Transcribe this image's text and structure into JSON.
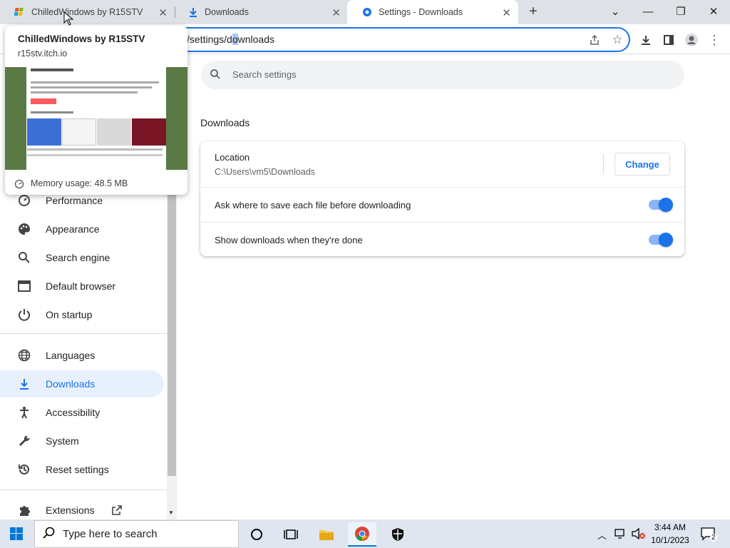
{
  "tabs": [
    {
      "title": "ChilledWindows by R15STV",
      "icon": "app-icon"
    },
    {
      "title": "Downloads",
      "icon": "download-icon"
    },
    {
      "title": "Settings - Downloads",
      "icon": "gear-icon"
    }
  ],
  "new_tab_label": "+",
  "window_controls": {
    "tab_search": "⌄",
    "minimize": "—",
    "restore": "❐",
    "close": "✕"
  },
  "address": {
    "prefix": "/settings/",
    "highlight": "o",
    "before_hl": "d",
    "after_hl": "wnloads"
  },
  "hovercard": {
    "title": "ChilledWindows by R15STV",
    "domain": "r15stv.itch.io",
    "memory": "Memory usage: 48.5 MB"
  },
  "sidebar": {
    "items": [
      {
        "label": "Performance",
        "icon": "speedometer-icon"
      },
      {
        "label": "Appearance",
        "icon": "palette-icon"
      },
      {
        "label": "Search engine",
        "icon": "search-icon"
      },
      {
        "label": "Default browser",
        "icon": "browser-icon"
      },
      {
        "label": "On startup",
        "icon": "power-icon"
      },
      {
        "label": "Languages",
        "icon": "globe-icon"
      },
      {
        "label": "Downloads",
        "icon": "download-icon"
      },
      {
        "label": "Accessibility",
        "icon": "accessibility-icon"
      },
      {
        "label": "System",
        "icon": "wrench-icon"
      },
      {
        "label": "Reset settings",
        "icon": "history-icon"
      },
      {
        "label": "Extensions",
        "icon": "puzzle-icon"
      }
    ]
  },
  "search": {
    "placeholder": "Search settings"
  },
  "section_title": "Downloads",
  "location": {
    "label": "Location",
    "path": "C:\\Users\\vm5\\Downloads",
    "change_label": "Change"
  },
  "settings": [
    {
      "label": "Ask where to save each file before downloading",
      "enabled": true
    },
    {
      "label": "Show downloads when they're done",
      "enabled": true
    }
  ],
  "taskbar": {
    "search_placeholder": "Type here to search",
    "time": "3:44 AM",
    "date": "10/1/2023",
    "notification_count": "2"
  }
}
